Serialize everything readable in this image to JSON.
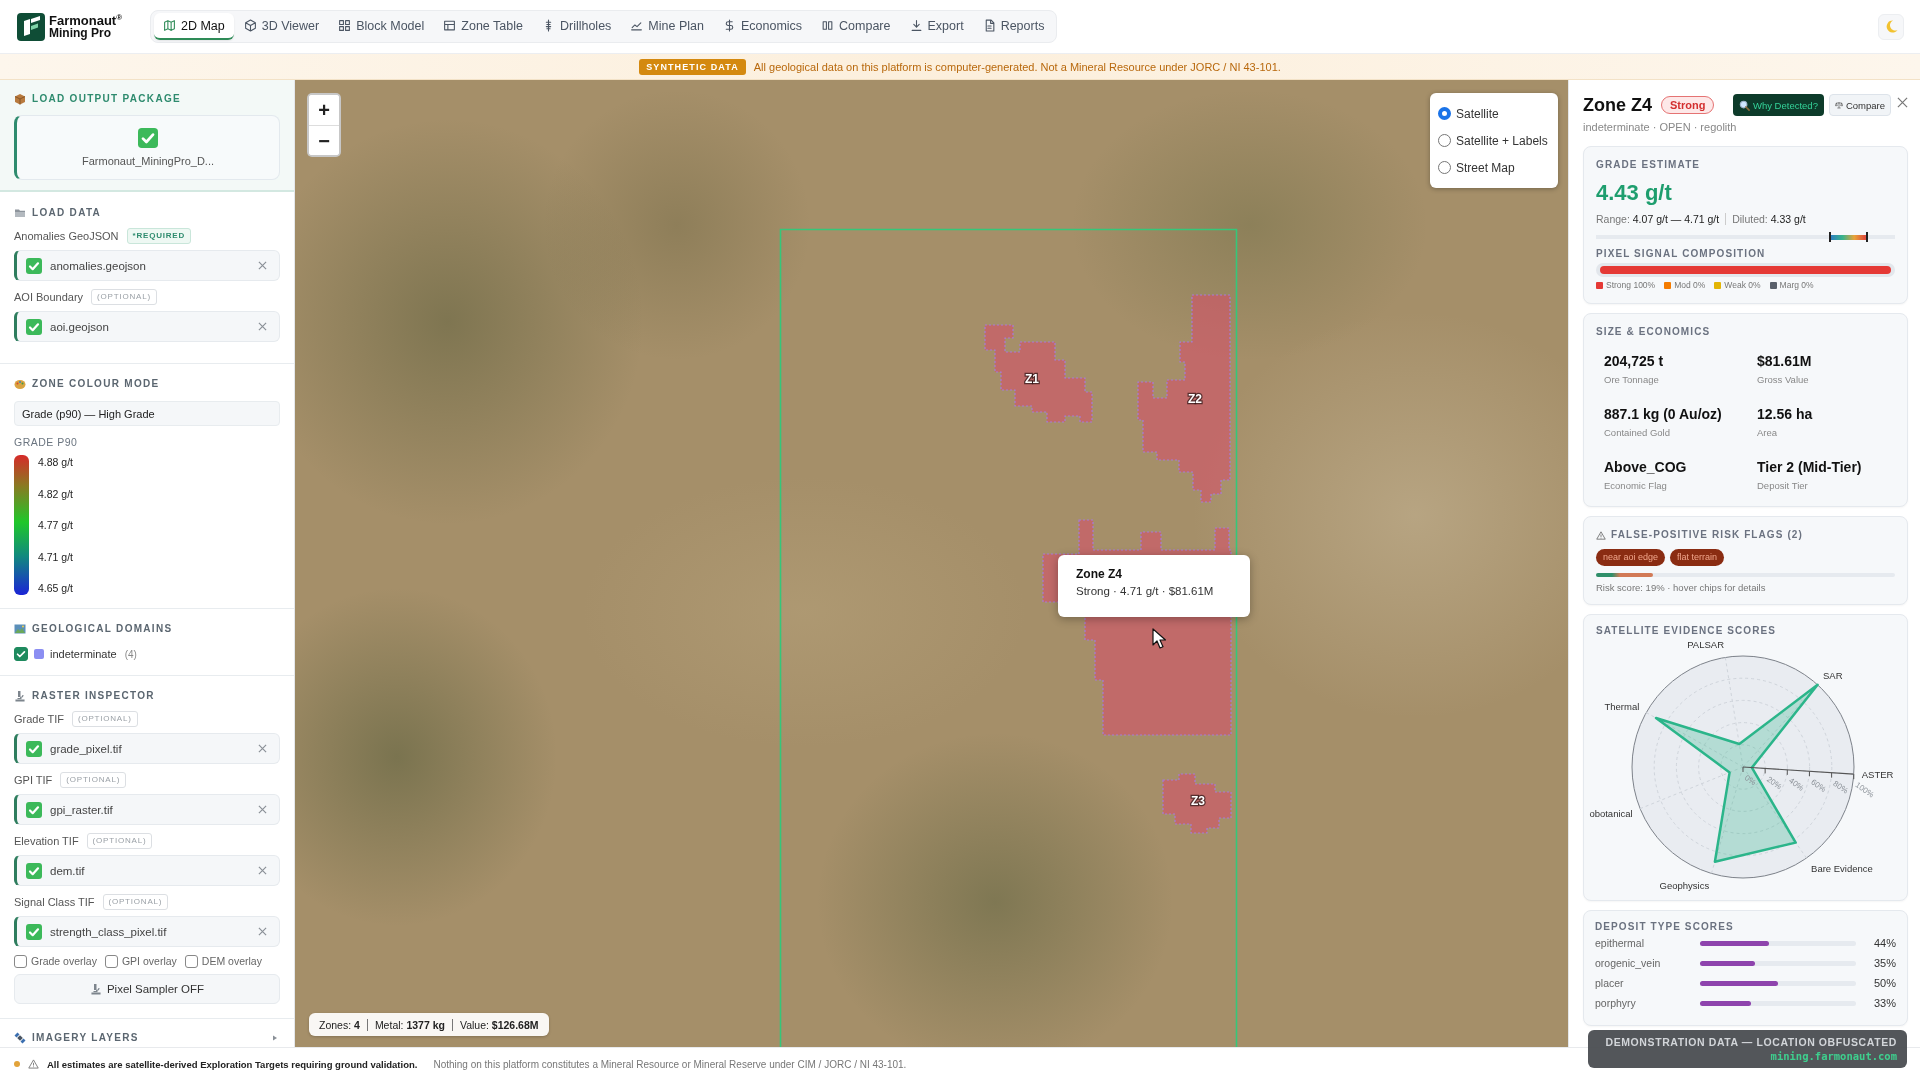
{
  "header": {
    "brand": {
      "name": "Farmonaut$^{®}$",
      "product": "Mining Pro"
    },
    "tabs": [
      {
        "label": "2D Map",
        "selected": true
      },
      {
        "label": "3D Viewer",
        "selected": false
      },
      {
        "label": "Block Model",
        "selected": false
      },
      {
        "label": "Zone Table",
        "selected": false
      },
      {
        "label": "Drillholes",
        "selected": false
      },
      {
        "label": "Mine Plan",
        "selected": false
      },
      {
        "label": "Economics",
        "selected": false
      },
      {
        "label": "Compare",
        "selected": false
      },
      {
        "label": "Export",
        "selected": false
      },
      {
        "label": "Reports",
        "selected": false
      }
    ]
  },
  "banner": {
    "badge": "SYNTHETIC DATA",
    "text": "All geological data on this platform is computer-generated. Not a Mineral Resource under JORC / NI 43-101."
  },
  "sidebar": {
    "output_package": {
      "title": "LOAD OUTPUT PACKAGE",
      "file": "Farmonaut_MiningPro_D..."
    },
    "load_data": {
      "title": "LOAD DATA",
      "inputs": [
        {
          "label": "Anomalies GeoJSON",
          "tag": "*REQUIRED",
          "required": true,
          "file": "anomalies.geojson"
        },
        {
          "label": "AOI Boundary",
          "tag": "(OPTIONAL)",
          "required": false,
          "file": "aoi.geojson"
        }
      ]
    },
    "colour_mode": {
      "title": "ZONE COLOUR MODE",
      "value": "Grade (p90) — High Grade",
      "legend_title": "GRADE P90",
      "legend": [
        "4.88 g/t",
        "4.82 g/t",
        "4.77 g/t",
        "4.71 g/t",
        "4.65 g/t"
      ]
    },
    "domains": {
      "title": "GEOLOGICAL DOMAINS",
      "items": [
        {
          "label": "indeterminate",
          "count": "(4)",
          "checked": true,
          "color": "#8b8ef2"
        }
      ]
    },
    "raster": {
      "title": "RASTER INSPECTOR",
      "inputs": [
        {
          "label": "Grade TIF",
          "tag": "(OPTIONAL)",
          "required": false,
          "file": "grade_pixel.tif"
        },
        {
          "label": "GPI TIF",
          "tag": "(OPTIONAL)",
          "required": false,
          "file": "gpi_raster.tif"
        },
        {
          "label": "Elevation TIF",
          "tag": "(OPTIONAL)",
          "required": false,
          "file": "dem.tif"
        },
        {
          "label": "Signal Class TIF",
          "tag": "(OPTIONAL)",
          "required": false,
          "file": "strength_class_pixel.tif"
        }
      ],
      "overlays": [
        {
          "label": "Grade overlay",
          "checked": false
        },
        {
          "label": "GPI overlay",
          "checked": false
        },
        {
          "label": "DEM overlay",
          "checked": false
        }
      ],
      "sampler_button": "Pixel Sampler OFF"
    },
    "imagery": {
      "title": "IMAGERY LAYERS",
      "expanded": false
    }
  },
  "map": {
    "zoom_buttons": [
      "+",
      "−"
    ],
    "layers": [
      {
        "label": "Satellite",
        "selected": true
      },
      {
        "label": "Satellite + Labels",
        "selected": false
      },
      {
        "label": "Street Map",
        "selected": false
      }
    ],
    "zones": [
      {
        "label": "Z1"
      },
      {
        "label": "Z2"
      },
      {
        "label": "Z3"
      }
    ],
    "hover": {
      "title": "Zone Z4",
      "text": "Strong · 4.71 g/t · $81.61M"
    },
    "stats": [
      "Zones: **4**",
      "Metal: **1377 kg**",
      "Value: **$126.68M**"
    ]
  },
  "detail": {
    "title": "Zone Z4",
    "signal": "Strong",
    "why_button": "Why Detected?",
    "compare_button": "Compare",
    "subtitle": "indeterminate · OPEN · regolith",
    "grade": {
      "title": "GRADE ESTIMATE",
      "value": "4.43 g/t",
      "range": {
        "label": "Range:",
        "value": "4.07 g/t — 4.71 g/t"
      },
      "diluted": {
        "label": "Diluted:",
        "value": "4.33 g/t"
      }
    },
    "composition": {
      "title": "PIXEL SIGNAL COMPOSITION",
      "segments": [
        {
          "label": "Strong 100%",
          "color": "#e53935",
          "level": 1
        },
        {
          "label": "Mod 0%",
          "color": "#f57c00"
        },
        {
          "label": "Weak 0%",
          "color": "#e3b505"
        },
        {
          "label": "Marg 0%",
          "color": "#5a606b"
        }
      ]
    },
    "economics": {
      "title": "SIZE & ECONOMICS",
      "metrics": [
        {
          "value": "204,725 t",
          "label": "Ore Tonnage"
        },
        {
          "value": "$81.61M",
          "label": "Gross Value"
        },
        {
          "value": "887.1 kg (0 Au/oz)",
          "label": "Contained Gold"
        },
        {
          "value": "12.56 ha",
          "label": "Area"
        },
        {
          "value": "Above_COG",
          "label": "Economic Flag"
        },
        {
          "value": "Tier 2 (Mid-Tier)",
          "label": "Deposit Tier"
        }
      ]
    },
    "risk": {
      "title": "FALSE-POSITIVE RISK FLAGS (2)",
      "flags": [
        "near aoi edge",
        "flat terrain"
      ],
      "level": 0.19,
      "note": "Risk score: 19% · hover chips for details"
    },
    "evidence": {
      "chart_data": {
        "type": "radar",
        "title": "SATELLITE EVIDENCE SCORES",
        "categories": [
          "PALSAR",
          "SAR",
          "ASTER",
          "Bare Evidence",
          "Geophysics",
          "obotanical",
          "Thermal"
        ],
        "values": [
          21,
          100,
          8,
          83,
          89,
          13,
          90
        ],
        "ylim": [
          0,
          100
        ],
        "yticks": [
          {
            "value": 0,
            "label": "0%"
          },
          {
            "value": 20,
            "label": "20%"
          },
          {
            "value": 40,
            "label": "40%"
          },
          {
            "value": 60,
            "label": "60%"
          },
          {
            "value": 80,
            "label": "80%"
          },
          {
            "value": 100,
            "label": "100%"
          }
        ]
      }
    },
    "deposits": {
      "title": "DEPOSIT TYPE SCORES",
      "rows": [
        {
          "name": "epithermal",
          "level": 0.44,
          "value": "44%"
        },
        {
          "name": "orogenic_vein",
          "level": 0.35,
          "value": "35%"
        },
        {
          "name": "placer",
          "level": 0.5,
          "value": "50%"
        },
        {
          "name": "porphyry",
          "level": 0.33,
          "value": "33%"
        }
      ]
    }
  },
  "demo_badge": {
    "text": "DEMONSTRATION DATA — LOCATION OBFUSCATED",
    "url": "mining.farmonaut.com"
  },
  "footer": {
    "strong": "All estimates are satellite-derived Exploration Targets requiring ground validation.",
    "note": "Nothing on this platform constitutes a Mineral Resource or Mineral Reserve under CIM / JORC / NI 43-101."
  }
}
